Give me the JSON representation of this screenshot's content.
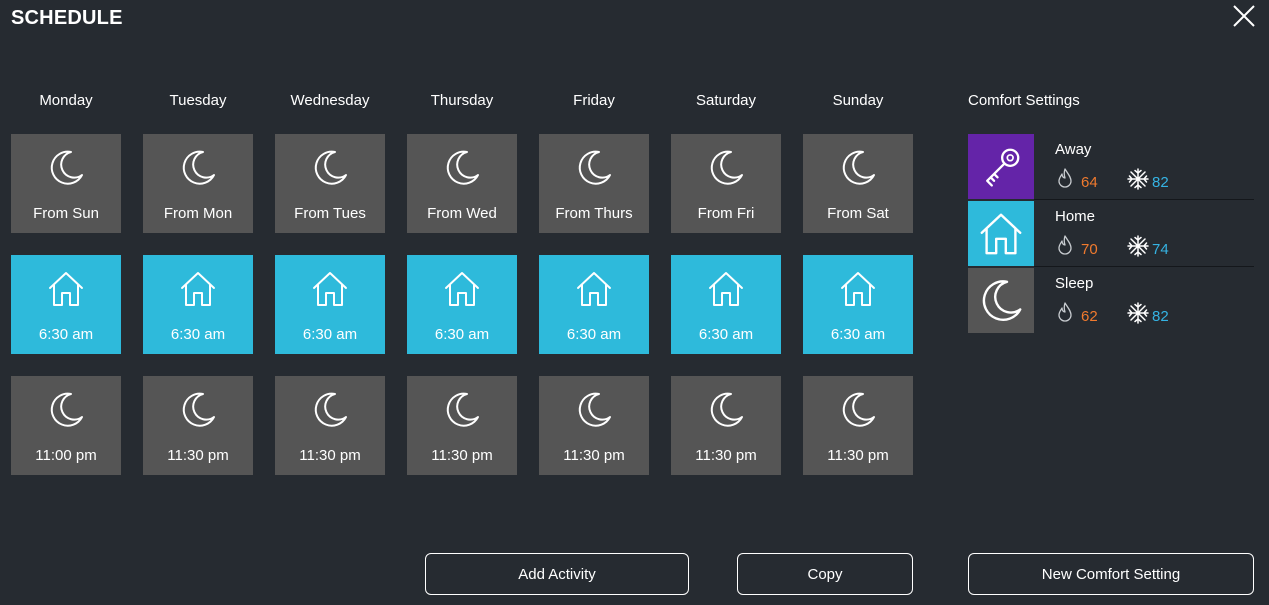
{
  "header": {
    "title": "SCHEDULE"
  },
  "days": [
    "Monday",
    "Tuesday",
    "Wednesday",
    "Thursday",
    "Friday",
    "Saturday",
    "Sunday"
  ],
  "schedule": [
    [
      {
        "type": "sleep",
        "icon": "moon-icon",
        "time": "From Sun"
      },
      {
        "type": "home",
        "icon": "home-icon",
        "time": "6:30 am"
      },
      {
        "type": "sleep",
        "icon": "moon-icon",
        "time": "11:00 pm"
      }
    ],
    [
      {
        "type": "sleep",
        "icon": "moon-icon",
        "time": "From Mon"
      },
      {
        "type": "home",
        "icon": "home-icon",
        "time": "6:30 am"
      },
      {
        "type": "sleep",
        "icon": "moon-icon",
        "time": "11:30 pm"
      }
    ],
    [
      {
        "type": "sleep",
        "icon": "moon-icon",
        "time": "From Tues"
      },
      {
        "type": "home",
        "icon": "home-icon",
        "time": "6:30 am"
      },
      {
        "type": "sleep",
        "icon": "moon-icon",
        "time": "11:30 pm"
      }
    ],
    [
      {
        "type": "sleep",
        "icon": "moon-icon",
        "time": "From Wed"
      },
      {
        "type": "home",
        "icon": "home-icon",
        "time": "6:30 am"
      },
      {
        "type": "sleep",
        "icon": "moon-icon",
        "time": "11:30 pm"
      }
    ],
    [
      {
        "type": "sleep",
        "icon": "moon-icon",
        "time": "From Thurs"
      },
      {
        "type": "home",
        "icon": "home-icon",
        "time": "6:30 am"
      },
      {
        "type": "sleep",
        "icon": "moon-icon",
        "time": "11:30 pm"
      }
    ],
    [
      {
        "type": "sleep",
        "icon": "moon-icon",
        "time": "From Fri"
      },
      {
        "type": "home",
        "icon": "home-icon",
        "time": "6:30 am"
      },
      {
        "type": "sleep",
        "icon": "moon-icon",
        "time": "11:30 pm"
      }
    ],
    [
      {
        "type": "sleep",
        "icon": "moon-icon",
        "time": "From Sat"
      },
      {
        "type": "home",
        "icon": "home-icon",
        "time": "6:30 am"
      },
      {
        "type": "sleep",
        "icon": "moon-icon",
        "time": "11:30 pm"
      }
    ]
  ],
  "comfort": {
    "title": "Comfort Settings",
    "items": [
      {
        "name": "Away",
        "icon": "key-icon",
        "color": "#6424a8",
        "heat": "64",
        "cool": "82"
      },
      {
        "name": "Home",
        "icon": "home-icon",
        "color": "#2ebadb",
        "heat": "70",
        "cool": "74"
      },
      {
        "name": "Sleep",
        "icon": "moon-icon",
        "color": "#555555",
        "heat": "62",
        "cool": "82"
      }
    ]
  },
  "buttons": {
    "add_activity": "Add Activity",
    "copy": "Copy",
    "new_comfort": "New Comfort Setting"
  },
  "colors": {
    "background": "#262b31",
    "home": "#2ebadb",
    "sleep": "#555555",
    "away": "#6424a8",
    "heat": "#f07a2e",
    "cool": "#35b3e3"
  }
}
